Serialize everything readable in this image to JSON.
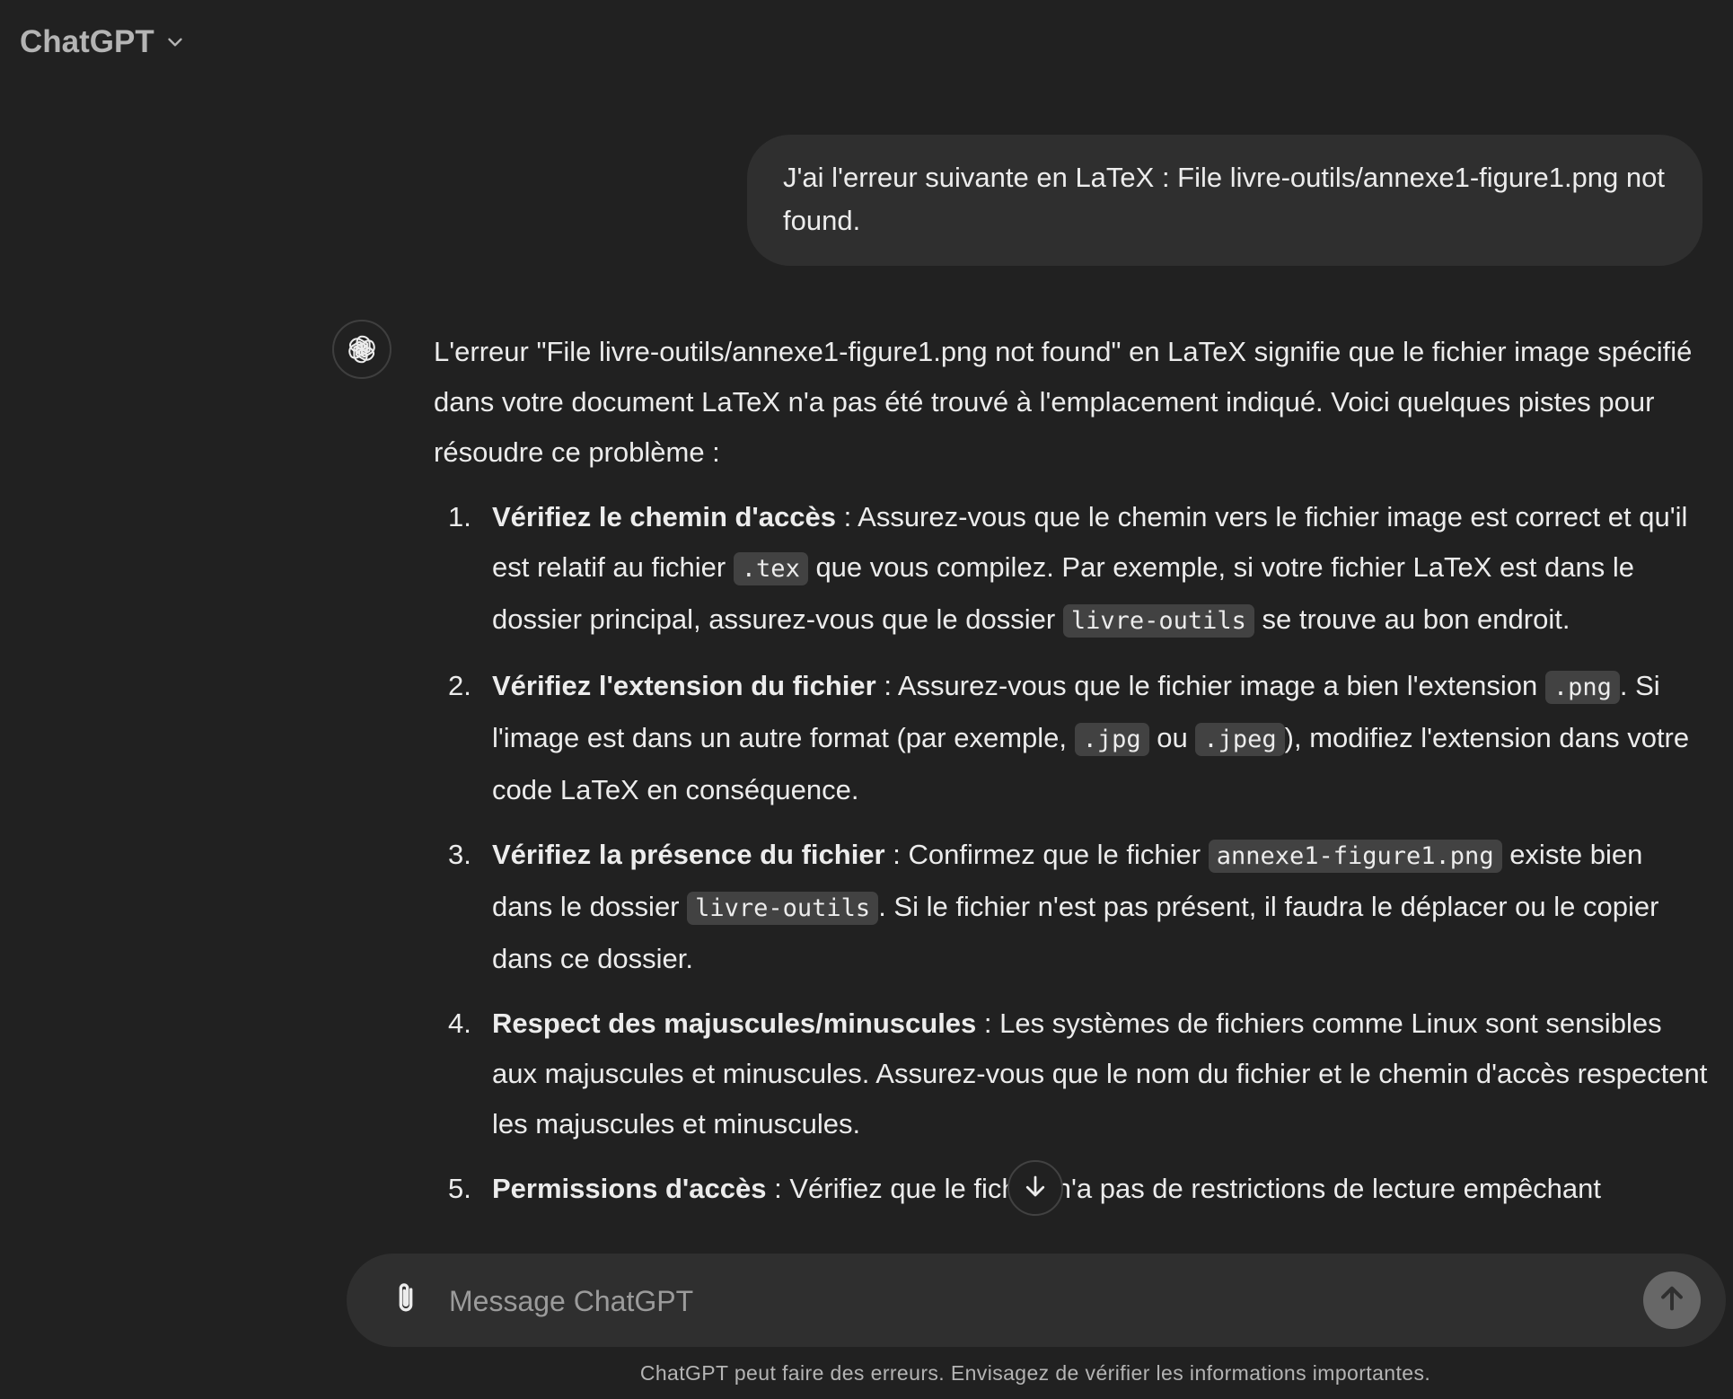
{
  "header": {
    "title": "ChatGPT",
    "menu_icon": "chevron-down-icon"
  },
  "conversation": {
    "user_message": "J'ai l'erreur suivante en LaTeX : File livre-outils/annexe1-figure1.png not found.",
    "assistant": {
      "avatar_icon": "openai-logo-icon",
      "intro": "L'erreur \"File livre-outils/annexe1-figure1.png not found\" en LaTeX signifie que le fichier image spécifié dans votre document LaTeX n'a pas été trouvé à l'emplacement indiqué. Voici quelques pistes pour résoudre ce problème :",
      "items": [
        {
          "num": "1.",
          "title": "Vérifiez le chemin d'accès",
          "t1": " : Assurez-vous que le chemin vers le fichier image est correct et qu'il est relatif au fichier ",
          "c1": ".tex",
          "t2": " que vous compilez. Par exemple, si votre fichier LaTeX est dans le dossier principal, assurez-vous que le dossier ",
          "c2": "livre-outils",
          "t3": " se trouve au bon endroit."
        },
        {
          "num": "2.",
          "title": "Vérifiez l'extension du fichier",
          "t1": " : Assurez-vous que le fichier image a bien l'extension ",
          "c1": ".png",
          "t2": ". Si l'image est dans un autre format (par exemple, ",
          "c2": ".jpg",
          "t3": " ou ",
          "c3": ".jpeg",
          "t4": "), modifiez l'extension dans votre code LaTeX en conséquence."
        },
        {
          "num": "3.",
          "title": "Vérifiez la présence du fichier",
          "t1": " : Confirmez que le fichier ",
          "c1": "annexe1-figure1.png",
          "t2": " existe bien dans le dossier ",
          "c2": "livre-outils",
          "t3": ". Si le fichier n'est pas présent, il faudra le déplacer ou le copier dans ce dossier."
        },
        {
          "num": "4.",
          "title": "Respect des majuscules/minuscules",
          "t1": " : Les systèmes de fichiers comme Linux sont sensibles aux majuscules et minuscules. Assurez-vous que le nom du fichier et le chemin d'accès respectent les majuscules et minuscules."
        },
        {
          "num": "5.",
          "title": "Permissions d'accès",
          "t1": " : Vérifiez que le fichier n'a pas de restrictions de lecture empêchant"
        }
      ]
    }
  },
  "scroll_button_icon": "arrow-down-icon",
  "composer": {
    "placeholder": "Message ChatGPT",
    "attach_icon": "paperclip-icon",
    "send_icon": "arrow-up-icon"
  },
  "footer": {
    "disclaimer": "ChatGPT peut faire des erreurs. Envisagez de vérifier les informations importantes."
  }
}
